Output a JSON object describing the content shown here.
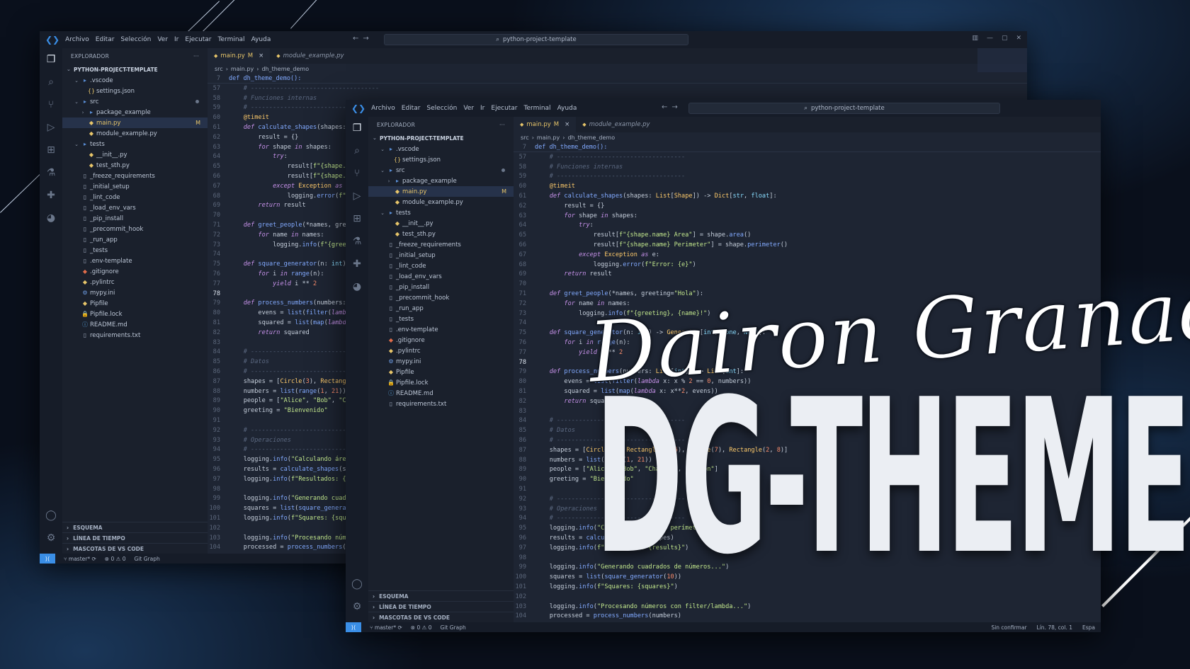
{
  "menu": [
    "Archivo",
    "Editar",
    "Selección",
    "Ver",
    "Ir",
    "Ejecutar",
    "Terminal",
    "Ayuda"
  ],
  "search_text": "python-project-template",
  "explorer": {
    "title": "EXPLORADOR",
    "more": "···",
    "project": "PYTHON-PROJECT-TEMPLATE",
    "items": [
      {
        "label": ".vscode",
        "depth": 1,
        "chev": "⌄",
        "icon": "folder-icon"
      },
      {
        "label": "settings.json",
        "depth": 2,
        "chev": "",
        "icon": "json-icon"
      },
      {
        "label": "src",
        "depth": 1,
        "chev": "⌄",
        "icon": "folder-icon",
        "dot": true
      },
      {
        "label": "package_example",
        "depth": 2,
        "chev": "›",
        "icon": "folder-icon"
      },
      {
        "label": "main.py",
        "depth": 2,
        "chev": "",
        "icon": "python-icon",
        "selected": true,
        "badge": "M"
      },
      {
        "label": "module_example.py",
        "depth": 2,
        "chev": "",
        "icon": "python-icon"
      },
      {
        "label": "tests",
        "depth": 1,
        "chev": "⌄",
        "icon": "folder-icon"
      },
      {
        "label": "__init__.py",
        "depth": 2,
        "chev": "",
        "icon": "python-icon"
      },
      {
        "label": "test_sth.py",
        "depth": 2,
        "chev": "",
        "icon": "python-icon"
      },
      {
        "label": "_freeze_requirements",
        "depth": 1,
        "chev": "",
        "icon": "file-icon"
      },
      {
        "label": "_initial_setup",
        "depth": 1,
        "chev": "",
        "icon": "file-icon"
      },
      {
        "label": "_lint_code",
        "depth": 1,
        "chev": "",
        "icon": "file-icon"
      },
      {
        "label": "_load_env_vars",
        "depth": 1,
        "chev": "",
        "icon": "file-icon"
      },
      {
        "label": "_pip_install",
        "depth": 1,
        "chev": "",
        "icon": "file-icon"
      },
      {
        "label": "_precommit_hook",
        "depth": 1,
        "chev": "",
        "icon": "file-icon"
      },
      {
        "label": "_run_app",
        "depth": 1,
        "chev": "",
        "icon": "file-icon"
      },
      {
        "label": "_tests",
        "depth": 1,
        "chev": "",
        "icon": "file-icon"
      },
      {
        "label": ".env-template",
        "depth": 1,
        "chev": "",
        "icon": "file-icon"
      },
      {
        "label": ".gitignore",
        "depth": 1,
        "chev": "",
        "icon": "git-icon"
      },
      {
        "label": ".pylintrc",
        "depth": 1,
        "chev": "",
        "icon": "python-icon"
      },
      {
        "label": "mypy.ini",
        "depth": 1,
        "chev": "",
        "icon": "gear-icon"
      },
      {
        "label": "Pipfile",
        "depth": 1,
        "chev": "",
        "icon": "python-icon"
      },
      {
        "label": "Pipfile.lock",
        "depth": 1,
        "chev": "",
        "icon": "lock-icon"
      },
      {
        "label": "README.md",
        "depth": 1,
        "chev": "",
        "icon": "info-icon"
      },
      {
        "label": "requirements.txt",
        "depth": 1,
        "chev": "",
        "icon": "file-icon"
      }
    ],
    "sections": [
      "ESQUEMA",
      "LÍNEA DE TIEMPO",
      "MASCOTAS DE VS CODE"
    ]
  },
  "tabs": [
    {
      "label": "main.py",
      "badge": "M",
      "close": "×",
      "active": true
    },
    {
      "label": "module_example.py",
      "badge": "",
      "close": "",
      "active": false
    }
  ],
  "breadcrumb": [
    "src",
    "main.py",
    "dh_theme_demo"
  ],
  "sticky": {
    "ln": "7",
    "code": "def dh_theme_demo():"
  },
  "status": {
    "branch": "master*",
    "problems": "⊗ 0 ⚠ 0",
    "git_graph": "Git Graph",
    "unconfirmed": "Sin confirmar",
    "position": "Lín. 78, col. 1",
    "spaces": "Espa"
  },
  "watermark": {
    "script": "Dairon Granada",
    "title": "DG-THEME"
  },
  "colors": {
    "accent": "#3a8ee6",
    "modified": "#e8c66a",
    "keyword": "#c792ea",
    "function": "#82aaff",
    "string": "#c3e88d"
  },
  "code_lines": [
    {
      "n": "57",
      "h": "<span class='c'>    # -----------------------------------</span>"
    },
    {
      "n": "58",
      "h": "<span class='c'>    # Funciones internas</span>"
    },
    {
      "n": "59",
      "h": "<span class='c'>    # -----------------------------------</span>"
    },
    {
      "n": "60",
      "h": "    <span class='d'>@timeit</span>"
    },
    {
      "n": "61",
      "h": "    <span class='k'>def</span> <span class='f'>calculate_shapes</span>(shapes: <span class='d'>List</span>[<span class='d'>Shape</span>]) -&gt; <span class='d'>Dict</span>[<span class='t'>str</span>, <span class='t'>float</span>]:"
    },
    {
      "n": "62",
      "h": "        result = {}"
    },
    {
      "n": "63",
      "h": "        <span class='k'>for</span> shape <span class='k'>in</span> shapes:"
    },
    {
      "n": "64",
      "h": "            <span class='k'>try</span>:"
    },
    {
      "n": "65",
      "h": "                result[<span class='s'>f\"{shape.name} Area\"</span>] = shape.<span class='f'>area</span>()"
    },
    {
      "n": "66",
      "h": "                result[<span class='s'>f\"{shape.name} Perimeter\"</span>] = shape.<span class='f'>perimeter</span>()"
    },
    {
      "n": "67",
      "h": "            <span class='k'>except</span> <span class='d'>Exception</span> <span class='k'>as</span> e:"
    },
    {
      "n": "68",
      "h": "                logging.<span class='f'>error</span>(<span class='s'>f\"Error: {e}\"</span>)"
    },
    {
      "n": "69",
      "h": "        <span class='k'>return</span> result"
    },
    {
      "n": "70",
      "h": ""
    },
    {
      "n": "71",
      "h": "    <span class='k'>def</span> <span class='f'>greet_people</span>(*names, greeting=<span class='s'>\"Hola\"</span>):"
    },
    {
      "n": "72",
      "h": "        <span class='k'>for</span> name <span class='k'>in</span> names:"
    },
    {
      "n": "73",
      "h": "            logging.<span class='f'>info</span>(<span class='s'>f\"{greeting}, {name}!\"</span>)"
    },
    {
      "n": "74",
      "h": ""
    },
    {
      "n": "75",
      "h": "    <span class='k'>def</span> <span class='f'>square_generator</span>(n: <span class='t'>int</span>) -&gt; <span class='d'>Generator</span>[<span class='t'>int</span>, <span class='t'>None</span>, <span class='t'>None</span>]:"
    },
    {
      "n": "76",
      "h": "        <span class='k'>for</span> i <span class='k'>in</span> <span class='f'>range</span>(n):"
    },
    {
      "n": "77",
      "h": "            <span class='k'>yield</span> i ** <span class='n'>2</span>"
    },
    {
      "n": "78",
      "h": "",
      "cur": true
    },
    {
      "n": "79",
      "h": "    <span class='k'>def</span> <span class='f'>process_numbers</span>(numbers: <span class='d'>List</span>[<span class='t'>int</span>]) -&gt; <span class='d'>List</span>[<span class='t'>int</span>]:"
    },
    {
      "n": "80",
      "h": "        evens = <span class='f'>list</span>(<span class='f'>filter</span>(<span class='k'>lambda</span> x: x % <span class='n'>2</span> == <span class='n'>0</span>, numbers))"
    },
    {
      "n": "81",
      "h": "        squared = <span class='f'>list</span>(<span class='f'>map</span>(<span class='k'>lambda</span> x: x**<span class='n'>2</span>, evens))"
    },
    {
      "n": "82",
      "h": "        <span class='k'>return</span> squared"
    },
    {
      "n": "83",
      "h": ""
    },
    {
      "n": "84",
      "h": "<span class='c'>    # -----------------------------------</span>"
    },
    {
      "n": "85",
      "h": "<span class='c'>    # Datos</span>"
    },
    {
      "n": "86",
      "h": "<span class='c'>    # -----------------------------------</span>"
    },
    {
      "n": "87",
      "h": "    shapes = [<span class='d'>Circle</span>(<span class='n'>3</span>), <span class='d'>Rectangle</span>(<span class='n'>4</span>, <span class='n'>5</span>), <span class='d'>Circle</span>(<span class='n'>7</span>), <span class='d'>Rectangle</span>(<span class='n'>2</span>, <span class='n'>8</span>)]"
    },
    {
      "n": "88",
      "h": "    numbers = <span class='f'>list</span>(<span class='f'>range</span>(<span class='n'>1</span>, <span class='n'>21</span>))"
    },
    {
      "n": "89",
      "h": "    people = [<span class='s'>\"Alice\"</span>, <span class='s'>\"Bob\"</span>, <span class='s'>\"Charlie\"</span>, <span class='s'>\"Dairon\"</span>]"
    },
    {
      "n": "90",
      "h": "    greeting = <span class='s'>\"Bienvenido\"</span>"
    },
    {
      "n": "91",
      "h": ""
    },
    {
      "n": "92",
      "h": "<span class='c'>    # -----------------------------------</span>"
    },
    {
      "n": "93",
      "h": "<span class='c'>    # Operaciones</span>"
    },
    {
      "n": "94",
      "h": "<span class='c'>    # -----------------------------------</span>"
    },
    {
      "n": "95",
      "h": "    logging.<span class='f'>info</span>(<span class='s'>\"Calculando áreas y perímetros...\"</span>)"
    },
    {
      "n": "96",
      "h": "    results = <span class='f'>calculate_shapes</span>(shapes)"
    },
    {
      "n": "97",
      "h": "    logging.<span class='f'>info</span>(<span class='s'>f\"Resultados: {results}\"</span>)"
    },
    {
      "n": "98",
      "h": ""
    },
    {
      "n": "99",
      "h": "    logging.<span class='f'>info</span>(<span class='s'>\"Generando cuadrados de números...\"</span>)"
    },
    {
      "n": "100",
      "h": "    squares = <span class='f'>list</span>(<span class='f'>square_generator</span>(<span class='n'>10</span>))"
    },
    {
      "n": "101",
      "h": "    logging.<span class='f'>info</span>(<span class='s'>f\"Squares: {squares}\"</span>)"
    },
    {
      "n": "102",
      "h": ""
    },
    {
      "n": "103",
      "h": "    logging.<span class='f'>info</span>(<span class='s'>\"Procesando números con filter/lambda...\"</span>)"
    },
    {
      "n": "104",
      "h": "    processed = <span class='f'>process_numbers</span>(numbers)"
    }
  ]
}
